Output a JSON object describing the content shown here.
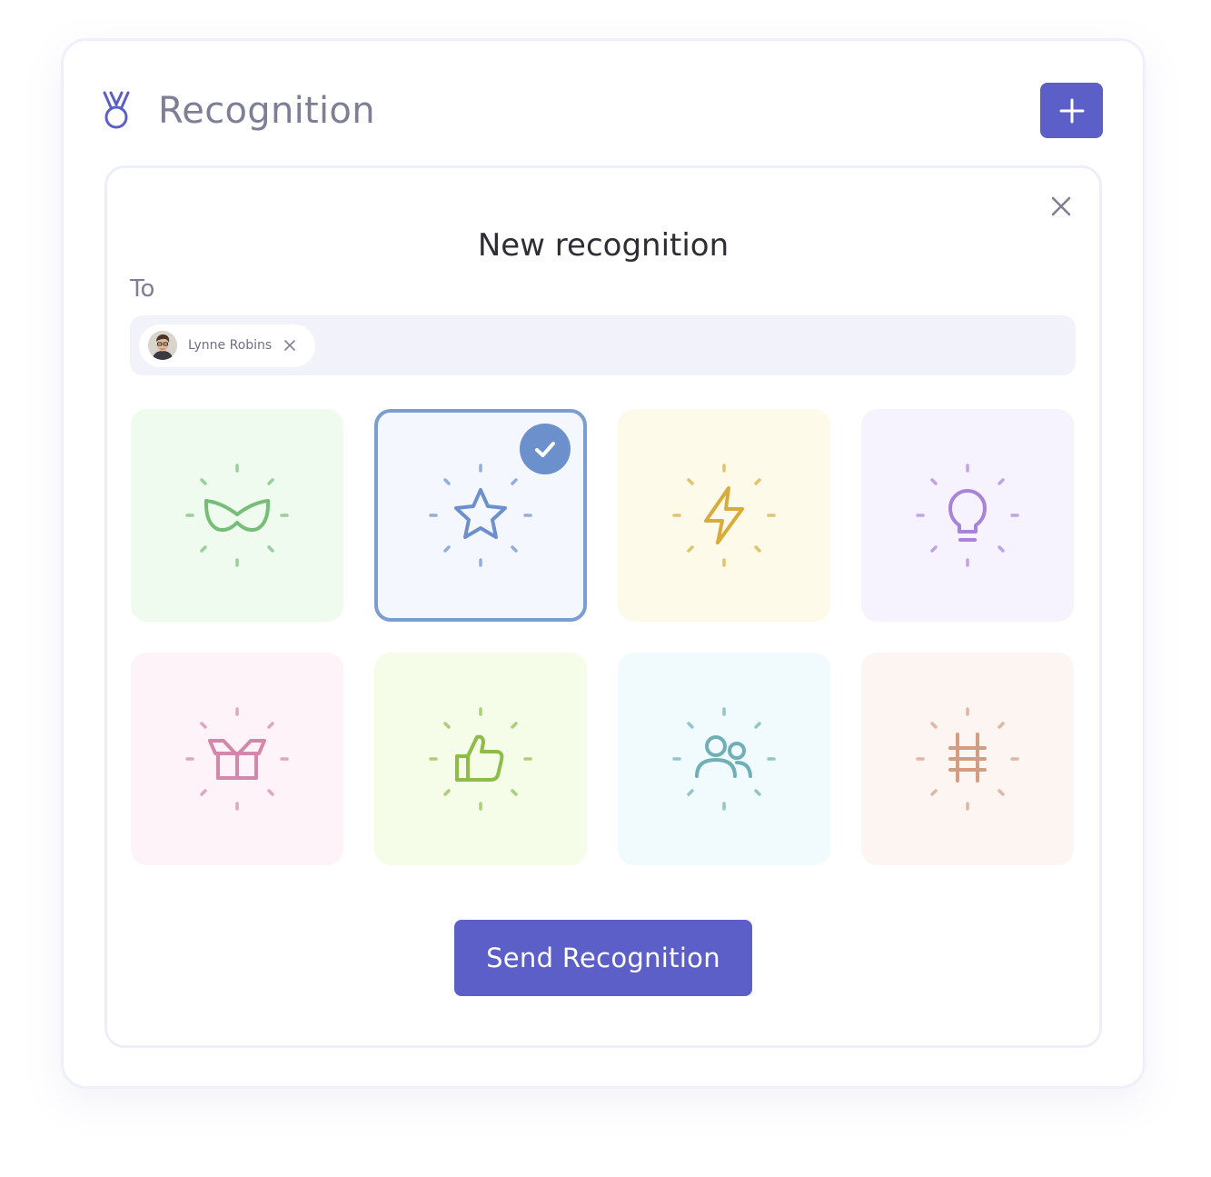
{
  "header": {
    "title": "Recognition",
    "logo_icon": "medal-icon",
    "add_icon": "plus-icon",
    "accent_color": "#5b5fc7"
  },
  "dialog": {
    "title": "New recognition",
    "close_icon": "close-icon",
    "to_label": "To",
    "recipient": {
      "name": "Lynne Robins",
      "avatar_icon": "avatar",
      "remove_icon": "close-icon"
    }
  },
  "badges": [
    {
      "icon": "mask-icon",
      "background": "#eefbee",
      "color": "#76bd78",
      "selected": false
    },
    {
      "icon": "star-icon",
      "background": "#f4f8fe",
      "color": "#6b90cb",
      "selected": true
    },
    {
      "icon": "lightning-icon",
      "background": "#fefaea",
      "color": "#d7ac3a",
      "selected": false
    },
    {
      "icon": "lightbulb-icon",
      "background": "#f6f3fe",
      "color": "#a784d9",
      "selected": false
    },
    {
      "icon": "gift-icon",
      "background": "#fdf3f8",
      "color": "#d288aa",
      "selected": false
    },
    {
      "icon": "thumbs-up-icon",
      "background": "#f5fde8",
      "color": "#8dbc49",
      "selected": false
    },
    {
      "icon": "team-icon",
      "background": "#f1fafd",
      "color": "#6fb0b7",
      "selected": false
    },
    {
      "icon": "ladder-icon",
      "background": "#fdf5f2",
      "color": "#d39d83",
      "selected": false
    }
  ],
  "send_button": {
    "label": "Send Recognition"
  }
}
